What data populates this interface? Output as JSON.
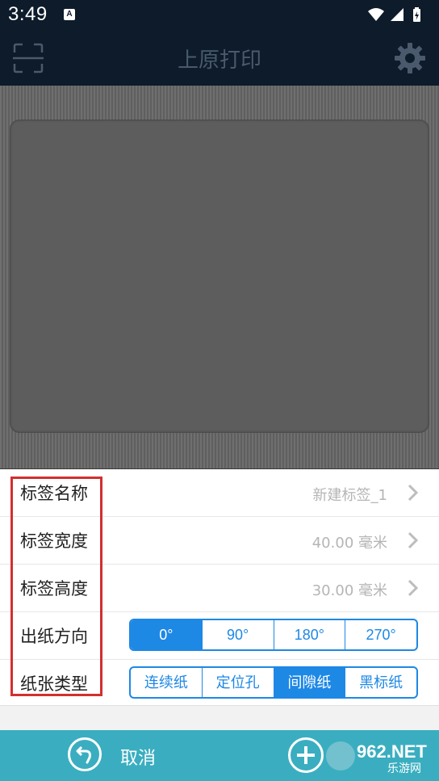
{
  "status_bar": {
    "time": "3:49",
    "notification_badge": "A",
    "icons": [
      "wifi-icon",
      "signal-icon",
      "battery-icon"
    ]
  },
  "app_bar": {
    "title": "上原打印",
    "left_icon": "scan-icon",
    "right_icon": "gear-icon"
  },
  "label_settings": {
    "name": {
      "label": "标签名称",
      "value": "新建标签_1"
    },
    "width": {
      "label": "标签宽度",
      "value": "40.00 毫米"
    },
    "height": {
      "label": "标签高度",
      "value": "30.00 毫米"
    },
    "direction": {
      "label": "出纸方向",
      "options": [
        "0°",
        "90°",
        "180°",
        "270°"
      ],
      "selected": "0°"
    },
    "paper_type": {
      "label": "纸张类型",
      "options": [
        "连续纸",
        "定位孔",
        "间隙纸",
        "黑标纸"
      ],
      "selected": "间隙纸"
    }
  },
  "bottom_bar": {
    "cancel_label": "取消",
    "add_icon": "plus-icon"
  },
  "watermark": {
    "line1": "962.NET",
    "line2": "乐游网"
  },
  "colors": {
    "accent": "#1e88e5",
    "app_bar": "#0d1b2a",
    "bottom_bar": "#3aaec0",
    "highlight": "#d32f2f"
  }
}
